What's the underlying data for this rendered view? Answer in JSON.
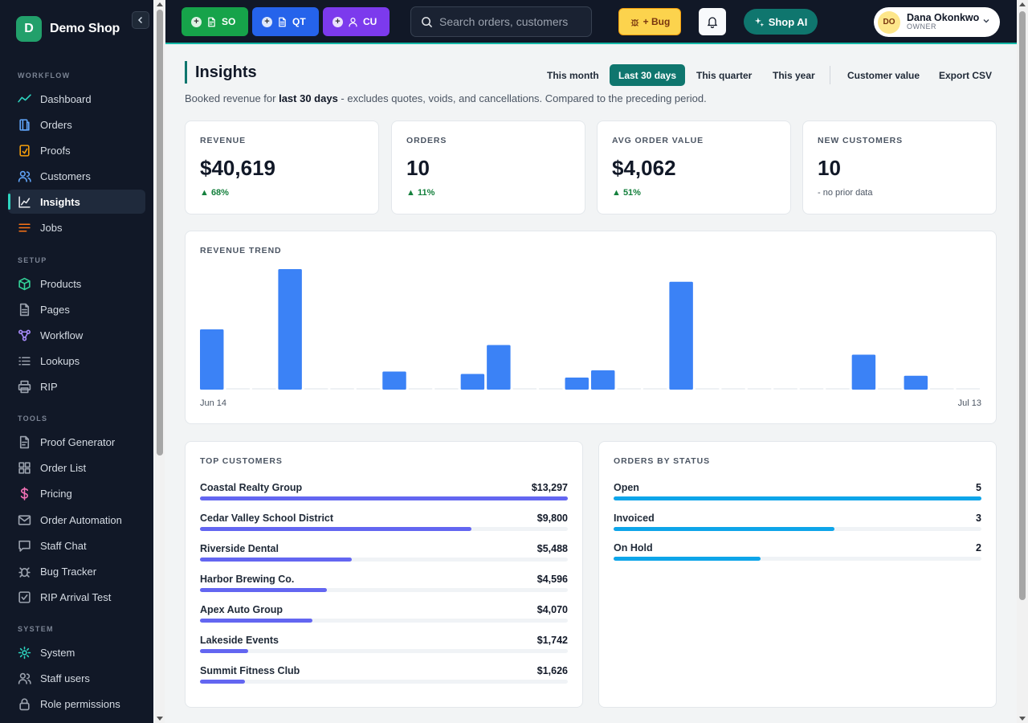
{
  "brand": {
    "initial": "D",
    "name": "Demo Shop"
  },
  "sidebar": {
    "sections": [
      {
        "title": "WORKFLOW",
        "items": [
          {
            "label": "Dashboard",
            "icon": "trend-icon",
            "color": "#2dd4bf"
          },
          {
            "label": "Orders",
            "icon": "orders-icon",
            "color": "#60a5fa"
          },
          {
            "label": "Proofs",
            "icon": "proofs-icon",
            "color": "#f59e0b"
          },
          {
            "label": "Customers",
            "icon": "users-icon",
            "color": "#60a5fa"
          },
          {
            "label": "Insights",
            "icon": "chart-icon",
            "color": "#e5e7eb",
            "active": true
          },
          {
            "label": "Jobs",
            "icon": "list-icon",
            "color": "#f97316"
          }
        ]
      },
      {
        "title": "SETUP",
        "items": [
          {
            "label": "Products",
            "icon": "box-icon",
            "color": "#34d399"
          },
          {
            "label": "Pages",
            "icon": "page-icon",
            "color": "#9ca3af"
          },
          {
            "label": "Workflow",
            "icon": "workflow-icon",
            "color": "#a78bfa"
          },
          {
            "label": "Lookups",
            "icon": "lookups-icon",
            "color": "#9ca3af"
          },
          {
            "label": "RIP",
            "icon": "printer-icon",
            "color": "#9ca3af"
          }
        ]
      },
      {
        "title": "TOOLS",
        "items": [
          {
            "label": "Proof Generator",
            "icon": "doc-icon",
            "color": "#9ca3af"
          },
          {
            "label": "Order List",
            "icon": "grid-icon",
            "color": "#9ca3af"
          },
          {
            "label": "Pricing",
            "icon": "dollar-icon",
            "color": "#f472b6"
          },
          {
            "label": "Order Automation",
            "icon": "mail-icon",
            "color": "#9ca3af"
          },
          {
            "label": "Staff Chat",
            "icon": "chat-icon",
            "color": "#9ca3af"
          },
          {
            "label": "Bug Tracker",
            "icon": "bug-icon",
            "color": "#9ca3af"
          },
          {
            "label": "RIP Arrival Test",
            "icon": "check-icon",
            "color": "#9ca3af"
          }
        ]
      },
      {
        "title": "SYSTEM",
        "items": [
          {
            "label": "System",
            "icon": "gear-icon",
            "color": "#2dd4bf"
          },
          {
            "label": "Staff users",
            "icon": "users-icon",
            "color": "#9ca3af"
          },
          {
            "label": "Role permissions",
            "icon": "lock-icon",
            "color": "#9ca3af"
          }
        ]
      }
    ]
  },
  "topbar": {
    "quick": [
      {
        "label": "SO",
        "color": "#16a34a",
        "icon": "doc-icon"
      },
      {
        "label": "QT",
        "color": "#2563eb",
        "icon": "page-icon"
      },
      {
        "label": "CU",
        "color": "#7c3aed",
        "icon": "user-icon"
      }
    ],
    "search_placeholder": "Search orders, customers",
    "bug_label": "+ Bug",
    "ai_label": "Shop AI",
    "user": {
      "initials": "DO",
      "name": "Dana Okonkwo",
      "role": "OWNER"
    }
  },
  "page": {
    "title": "Insights",
    "subtitle_pre": "Booked revenue for ",
    "subtitle_bold": "last 30 days",
    "subtitle_post": " - excludes quotes, voids, and cancellations. Compared to the preceding period.",
    "ranges": [
      "This month",
      "Last 30 days",
      "This quarter",
      "This year"
    ],
    "active_range": "Last 30 days",
    "actions": [
      "Customer value",
      "Export CSV"
    ]
  },
  "kpis": [
    {
      "label": "REVENUE",
      "value": "$40,619",
      "delta": "▲ 68%",
      "up": true
    },
    {
      "label": "ORDERS",
      "value": "10",
      "delta": "▲ 11%",
      "up": true
    },
    {
      "label": "AVG ORDER VALUE",
      "value": "$4,062",
      "delta": "▲ 51%",
      "up": true
    },
    {
      "label": "NEW CUSTOMERS",
      "value": "10",
      "delta": "- no prior data",
      "up": false
    }
  ],
  "chart_data": {
    "type": "bar",
    "title": "REVENUE TREND",
    "x_start": "Jun 14",
    "x_end": "Jul 13",
    "color": "#3b82f6",
    "values": [
      5000,
      0,
      0,
      10000,
      0,
      0,
      0,
      1500,
      0,
      0,
      1300,
      3700,
      0,
      0,
      1000,
      1600,
      0,
      0,
      8950,
      0,
      0,
      0,
      0,
      0,
      0,
      2900,
      0,
      1150,
      0,
      0
    ],
    "ylim": [
      0,
      10000
    ]
  },
  "top_customers": {
    "title": "TOP CUSTOMERS",
    "color": "#6366f1",
    "max": 13297,
    "rows": [
      {
        "name": "Coastal Realty Group",
        "display": "$13,297",
        "value": 13297
      },
      {
        "name": "Cedar Valley School District",
        "display": "$9,800",
        "value": 9800
      },
      {
        "name": "Riverside Dental",
        "display": "$5,488",
        "value": 5488
      },
      {
        "name": "Harbor Brewing Co.",
        "display": "$4,596",
        "value": 4596
      },
      {
        "name": "Apex Auto Group",
        "display": "$4,070",
        "value": 4070
      },
      {
        "name": "Lakeside Events",
        "display": "$1,742",
        "value": 1742
      },
      {
        "name": "Summit Fitness Club",
        "display": "$1,626",
        "value": 1626
      }
    ]
  },
  "orders_by_status": {
    "title": "ORDERS BY STATUS",
    "color": "#0ea5e9",
    "max": 5,
    "rows": [
      {
        "name": "Open",
        "display": "5",
        "value": 5
      },
      {
        "name": "Invoiced",
        "display": "3",
        "value": 3
      },
      {
        "name": "On Hold",
        "display": "2",
        "value": 2
      }
    ]
  }
}
